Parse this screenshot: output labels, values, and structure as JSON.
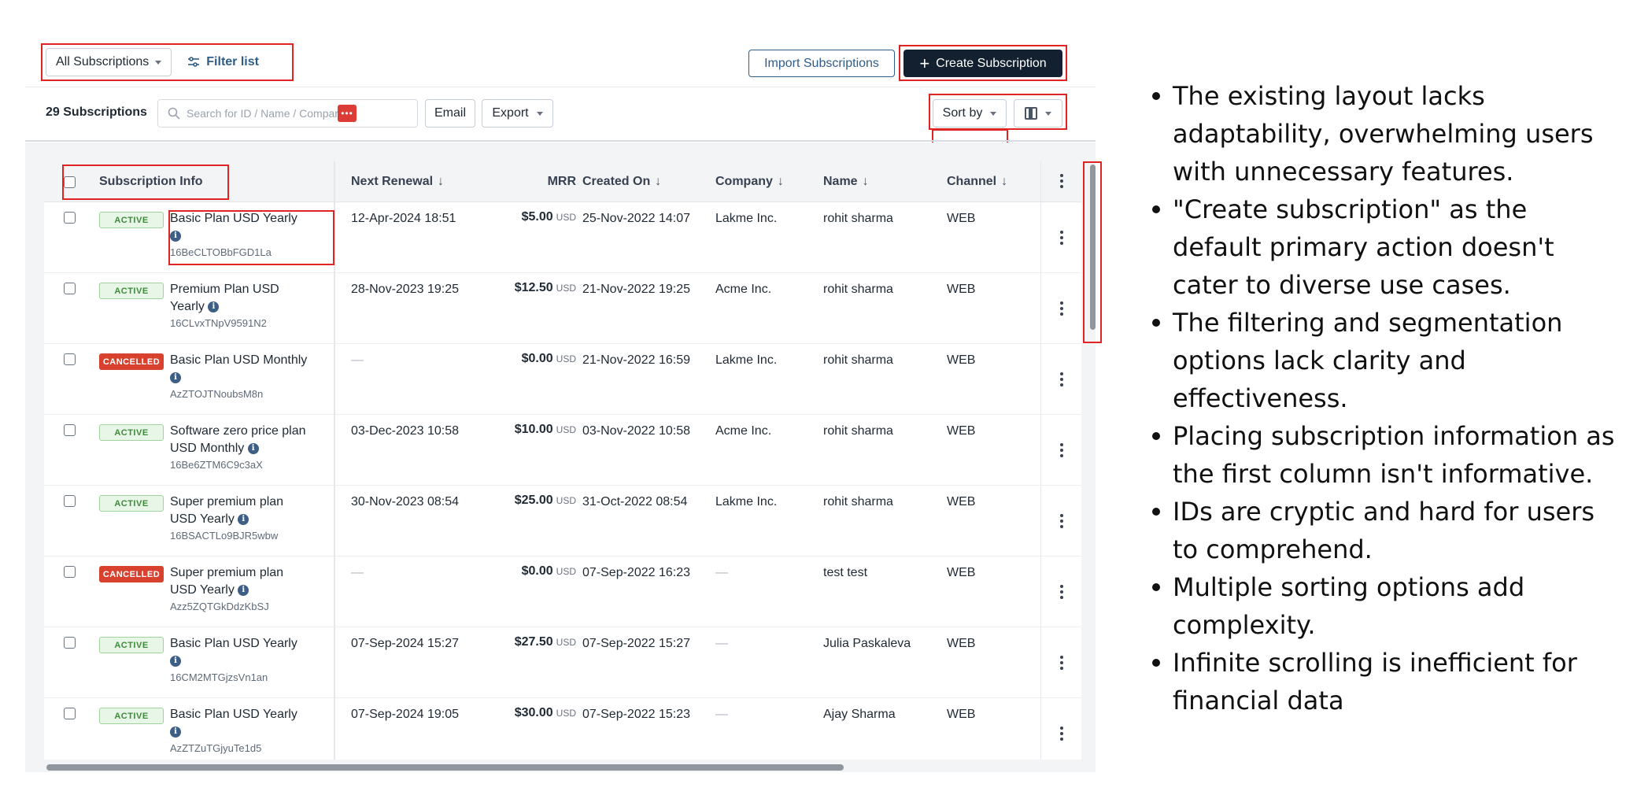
{
  "toolbar": {
    "view_select": "All Subscriptions",
    "filter_label": "Filter list",
    "import_label": "Import Subscriptions",
    "create_label": "Create Subscription"
  },
  "list_bar": {
    "count_number": "29",
    "count_text": "Subscriptions",
    "search_placeholder": "Search for ID / Name / Compar",
    "email_label": "Email",
    "export_label": "Export",
    "sort_label": "Sort by"
  },
  "table": {
    "headers": {
      "info": "Subscription Info",
      "renewal": "Next Renewal",
      "mrr": "MRR",
      "created": "Created On",
      "company": "Company",
      "name": "Name",
      "channel": "Channel"
    },
    "rows": [
      {
        "status": "ACTIVE",
        "plan": "Basic Plan USD Yearly",
        "id": "16BeCLTOBbFGD1La",
        "renewal": "12-Apr-2024 18:51",
        "mrr": "$5.00",
        "currency": "USD",
        "created": "25-Nov-2022 14:07",
        "company": "Lakme Inc.",
        "name": "rohit sharma",
        "channel": "WEB"
      },
      {
        "status": "ACTIVE",
        "plan": "Premium Plan USD Yearly",
        "id": "16CLvxTNpV9591N2",
        "renewal": "28-Nov-2023 19:25",
        "mrr": "$12.50",
        "currency": "USD",
        "created": "21-Nov-2022 19:25",
        "company": "Acme Inc.",
        "name": "rohit sharma",
        "channel": "WEB"
      },
      {
        "status": "CANCELLED",
        "plan": "Basic Plan USD Monthly",
        "id": "AzZTOJTNoubsM8n",
        "renewal": "—",
        "mrr": "$0.00",
        "currency": "USD",
        "created": "21-Nov-2022 16:59",
        "company": "Lakme Inc.",
        "name": "rohit sharma",
        "channel": "WEB"
      },
      {
        "status": "ACTIVE",
        "plan": "Software zero price plan USD Monthly",
        "id": "16Be6ZTM6C9c3aX",
        "renewal": "03-Dec-2023 10:58",
        "mrr": "$10.00",
        "currency": "USD",
        "created": "03-Nov-2022 10:58",
        "company": "Acme Inc.",
        "name": "rohit sharma",
        "channel": "WEB"
      },
      {
        "status": "ACTIVE",
        "plan": "Super premium plan USD Yearly",
        "id": "16BSACTLo9BJR5wbw",
        "renewal": "30-Nov-2023 08:54",
        "mrr": "$25.00",
        "currency": "USD",
        "created": "31-Oct-2022 08:54",
        "company": "Lakme Inc.",
        "name": "rohit sharma",
        "channel": "WEB"
      },
      {
        "status": "CANCELLED",
        "plan": "Super premium plan USD Yearly",
        "id": "Azz5ZQTGkDdzKbSJ",
        "renewal": "—",
        "mrr": "$0.00",
        "currency": "USD",
        "created": "07-Sep-2022 16:23",
        "company": "—",
        "name": "test test",
        "channel": "WEB"
      },
      {
        "status": "ACTIVE",
        "plan": "Basic Plan USD Yearly",
        "id": "16CM2MTGjzsVn1an",
        "renewal": "07-Sep-2024 15:27",
        "mrr": "$27.50",
        "currency": "USD",
        "created": "07-Sep-2022 15:27",
        "company": "—",
        "name": "Julia Paskaleva",
        "channel": "WEB"
      },
      {
        "status": "ACTIVE",
        "plan": "Basic Plan USD Yearly",
        "id": "AzZTZuTGjyuTe1d5",
        "renewal": "07-Sep-2024 19:05",
        "mrr": "$30.00",
        "currency": "USD",
        "created": "07-Sep-2022 15:23",
        "company": "—",
        "name": "Ajay Sharma",
        "channel": "WEB"
      }
    ]
  },
  "notes": [
    "The existing layout lacks adaptability, overwhelming users with unnecessary features.",
    "\"Create subscription\" as the default primary action doesn't cater to diverse use cases.",
    "The filtering and segmentation options lack clarity and effectiveness.",
    "Placing subscription information as the first column isn't informative.",
    "IDs are cryptic and hard for users to comprehend.",
    "Multiple sorting options add complexity.",
    "Infinite scrolling is inefficient for financial data"
  ],
  "colors": {
    "primary": "#12202f",
    "link": "#2f5d8a",
    "highlight": "#e02424",
    "active": "#3d8a3a",
    "cancelled": "#d9412f"
  }
}
